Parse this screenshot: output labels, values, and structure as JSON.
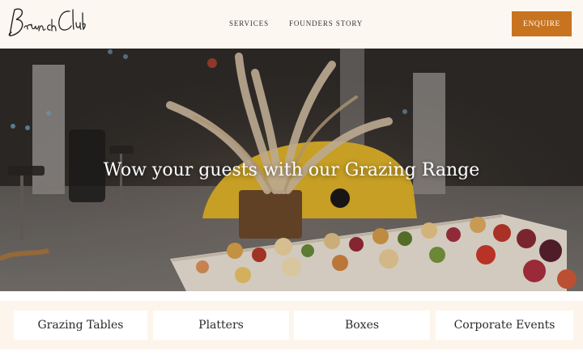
{
  "header": {
    "logo_text": "Brunch Club",
    "nav": {
      "services": "SERVICES",
      "founders_story": "FOUNDERS STORY"
    },
    "enquire_label": "ENQUIRE"
  },
  "hero": {
    "title": "Wow your guests with our Grazing Range",
    "image": "grazing-table-with-pampas-grass-photo"
  },
  "categories": [
    {
      "label": "Grazing Tables"
    },
    {
      "label": "Platters"
    },
    {
      "label": "Boxes"
    },
    {
      "label": "Corporate Events"
    }
  ],
  "colors": {
    "accent": "#c8731f",
    "header_bg": "#fdf7f1",
    "strip_bg": "#fdf5ec"
  }
}
